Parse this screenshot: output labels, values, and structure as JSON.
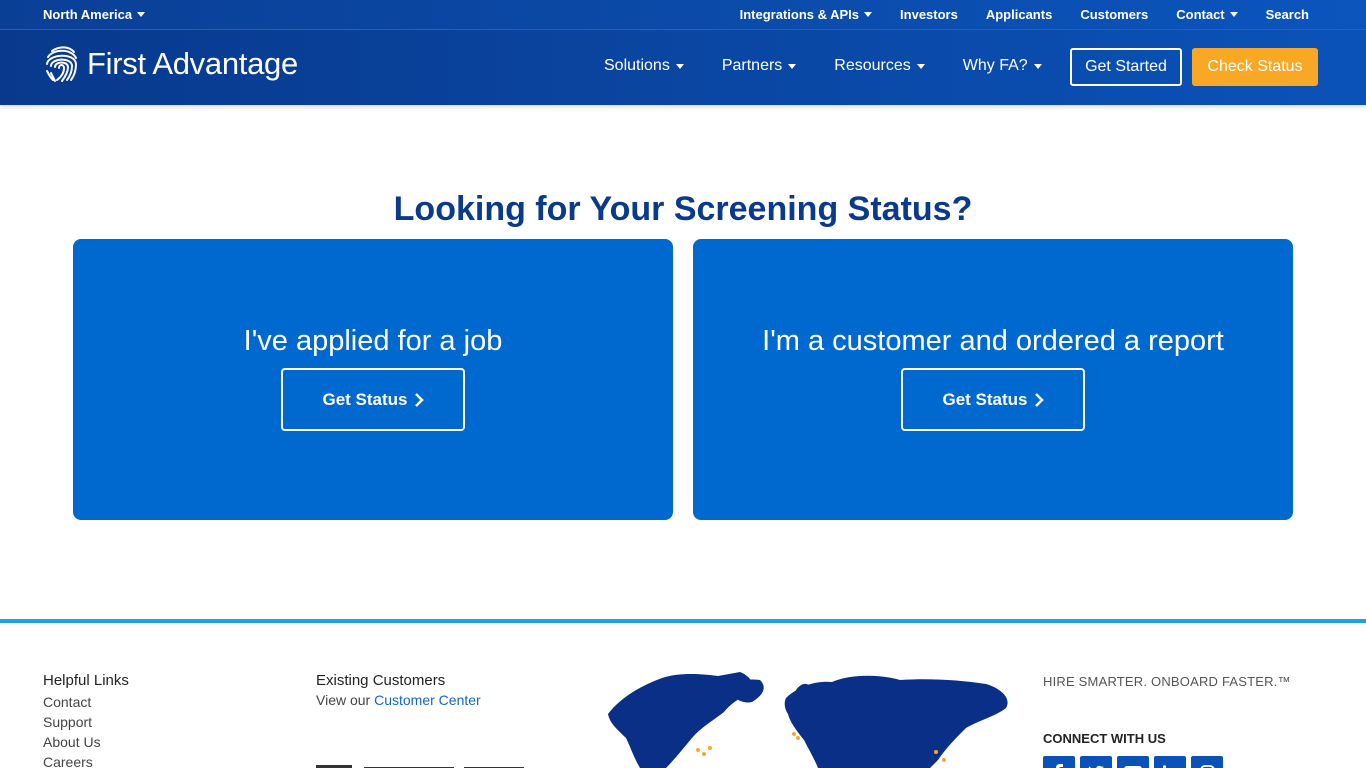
{
  "utility": {
    "region": "North America",
    "links": [
      {
        "label": "Integrations & APIs",
        "caret": true
      },
      {
        "label": "Investors",
        "caret": false
      },
      {
        "label": "Applicants",
        "caret": false
      },
      {
        "label": "Customers",
        "caret": false
      },
      {
        "label": "Contact",
        "caret": true
      },
      {
        "label": "Search",
        "caret": false
      }
    ]
  },
  "header": {
    "logo_text": "First Advantage",
    "nav": [
      "Solutions",
      "Partners",
      "Resources",
      "Why FA?"
    ],
    "get_started": "Get Started",
    "check_status": "Check Status"
  },
  "hero": {
    "title": "Looking for Your Screening Status?",
    "cards": [
      {
        "heading": "I've applied for a job",
        "button": "Get Status"
      },
      {
        "heading": "I'm a customer and ordered a report",
        "button": "Get Status"
      }
    ]
  },
  "footer": {
    "helpful_links_heading": "Helpful Links",
    "helpful_links": [
      "Contact",
      "Support",
      "About Us",
      "Careers"
    ],
    "existing_customers_heading": "Existing Customers",
    "existing_customers_prefix": "View our",
    "customer_center_link": "Customer Center",
    "tagline": "HIRE SMARTER. ONBOARD FASTER.™",
    "connect": "CONNECT WITH US",
    "socials": [
      "facebook-icon",
      "twitter-icon",
      "youtube-icon",
      "linkedin-icon",
      "instagram-icon"
    ]
  },
  "colors": {
    "brand_blue": "#0a47a4",
    "card_blue": "#0069cf",
    "accent_orange": "#f9a825",
    "footer_rule": "#1fa3de",
    "title_blue": "#0a3a8c"
  }
}
